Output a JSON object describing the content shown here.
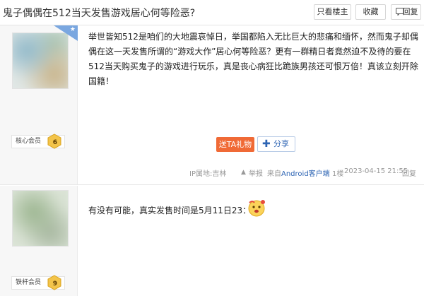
{
  "thread": {
    "title": "鬼子偶偶在512当天发售游戏居心何等险恶?",
    "buttons": {
      "only_op": "只看楼主",
      "favorite": "收藏",
      "reply": "回复"
    }
  },
  "posts": [
    {
      "member_label": "核心会员",
      "level": "6",
      "content": "举世皆知512是咱们的大地震哀悼日，举国都陷入无比巨大的悲痛和缅怀，然而鬼子却偶偶在这一天发售所谓的“游戏大作”居心何等险恶？更有一群精日者竟然迫不及待的要在512当天购买鬼子的游戏进行玩乐，真是丧心病狂比跪族男孩还可恨万倍！真该立刻开除国籍！",
      "gift_label": "送TA礼物",
      "share_label": "分享",
      "ip": "IP属地:吉林",
      "report": "举报",
      "client_prefix": "来自",
      "client_link": "Android客户端",
      "floor": "1楼",
      "time": "2023-04-15 21:55",
      "reply": "回复"
    },
    {
      "member_label": "铁杆会员",
      "level": "9",
      "content": "有没有可能，真实发售时间是5月11日23：00"
    }
  ],
  "colors": {
    "gift": "#f06a36",
    "link": "#2d64b3",
    "corner_tag": "#7aa7e0"
  }
}
